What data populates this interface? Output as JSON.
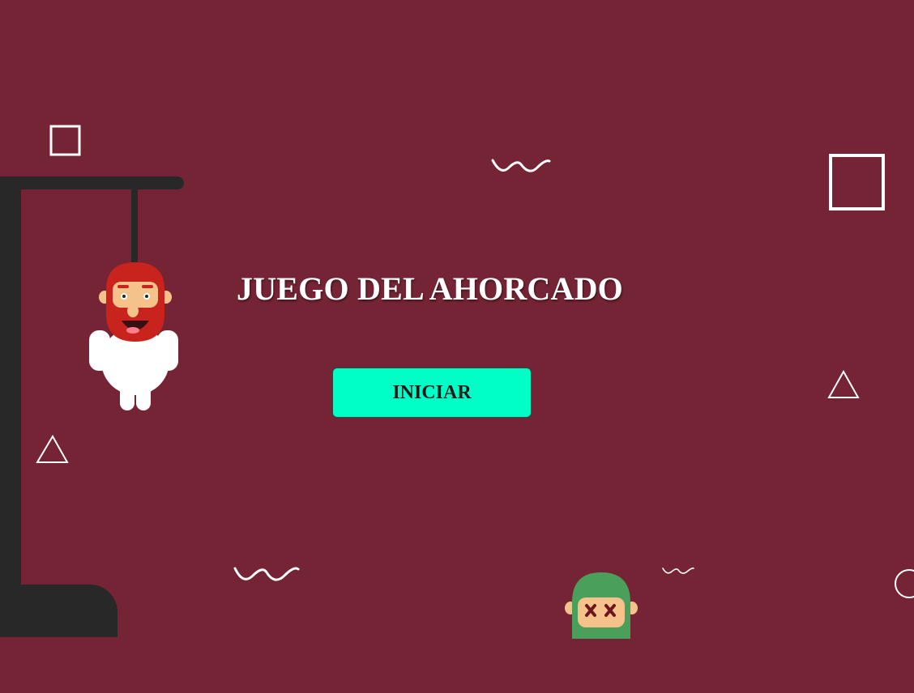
{
  "game": {
    "title": "JUEGO DEL AHORCADO",
    "start_label": "INICIAR"
  },
  "colors": {
    "background": "#742434",
    "button": "#00ffc6",
    "gallows": "#282828",
    "title_text": "#ffffff"
  },
  "decorations": {
    "icons": [
      "square-outline-icon",
      "triangle-outline-icon",
      "wave-icon",
      "circle-outline-icon"
    ]
  }
}
